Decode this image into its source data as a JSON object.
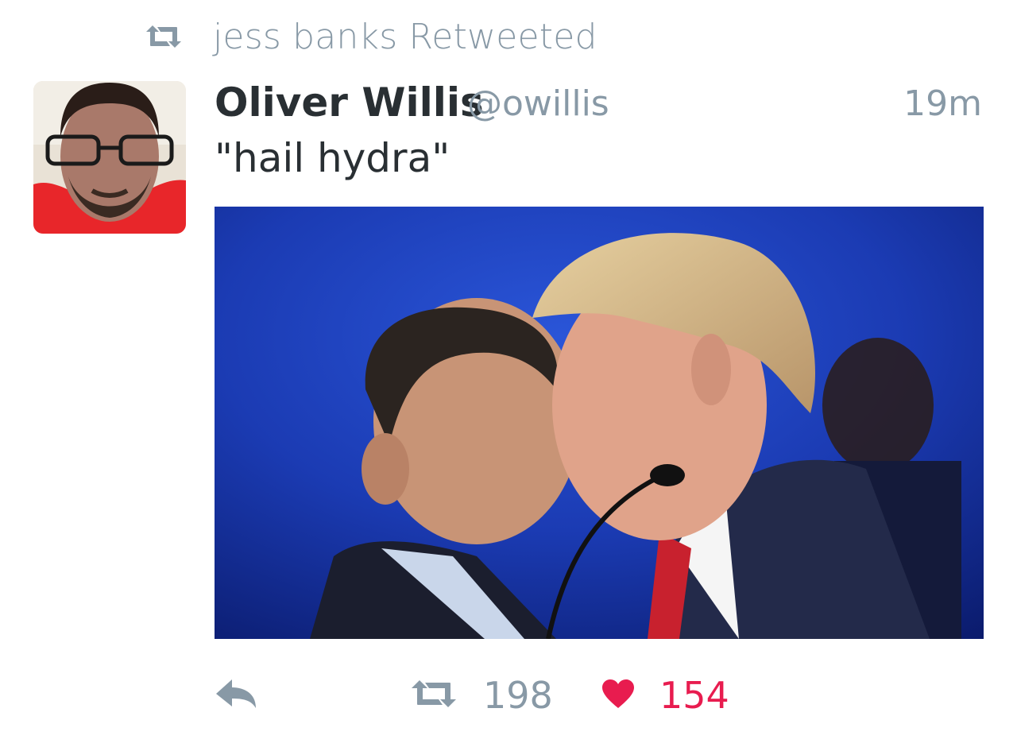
{
  "context": {
    "icon": "retweet-icon",
    "text": "jess banks Retweeted"
  },
  "tweet": {
    "avatar_icon": "user-avatar",
    "display_name": "Oliver Willis",
    "handle": "@owillis",
    "timestamp": "19m",
    "text": "\"hail hydra\"",
    "media_description_icon": "photo"
  },
  "actions": {
    "reply_icon": "reply-icon",
    "retweet_icon": "retweet-icon",
    "retweet_count": "198",
    "like_icon": "heart-icon",
    "like_count": "154"
  },
  "colors": {
    "muted": "#8899a6",
    "text": "#292f33",
    "like": "#e81c4f",
    "media_bg": "#1c3fb8"
  }
}
